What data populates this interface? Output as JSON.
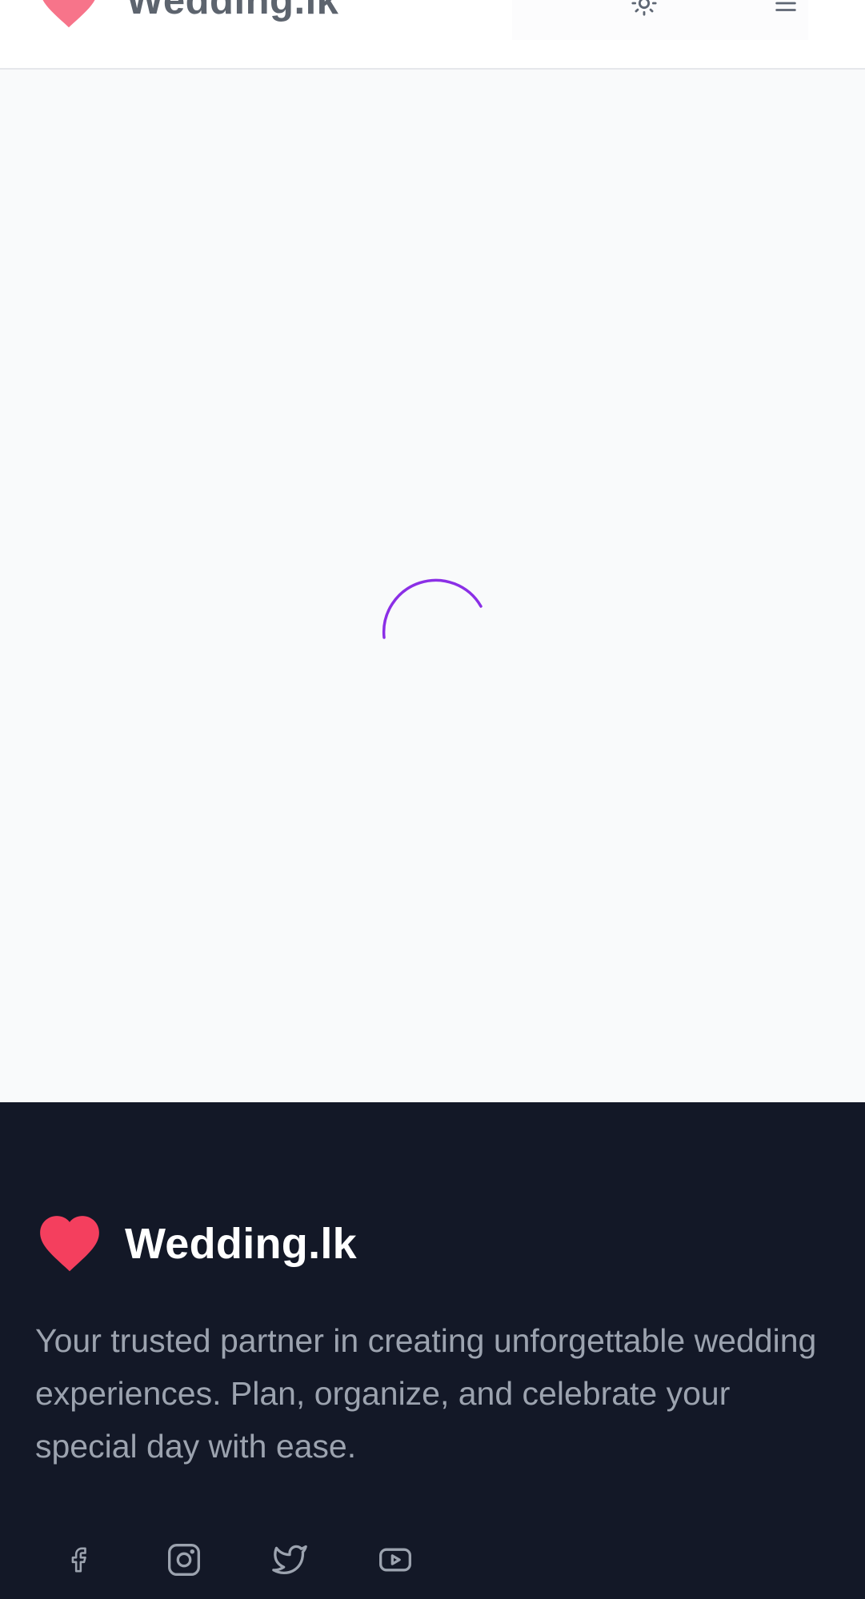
{
  "header": {
    "brand_name": "Wedding.lk",
    "logo_icon": "heart-icon",
    "theme_toggle_icon": "sun-icon",
    "menu_icon": "menu-icon"
  },
  "main": {
    "state": "loading",
    "spinner_icon": "loading-spinner-icon",
    "spinner_color": "#8b2fe6"
  },
  "footer": {
    "brand_name": "Wedding.lk",
    "logo_icon": "heart-icon",
    "logo_color": "#f43f5e",
    "tagline": "Your trusted partner in creating unforgettable wedding experiences. Plan, organize, and celebrate your special day with ease.",
    "socials": [
      {
        "icon": "facebook-icon"
      },
      {
        "icon": "instagram-icon"
      },
      {
        "icon": "twitter-icon"
      },
      {
        "icon": "youtube-icon"
      }
    ]
  },
  "colors": {
    "page_background": "#f9fafb",
    "footer_background": "#131827",
    "accent_heart": "#f43f5e",
    "spinner": "#8b2fe6"
  }
}
